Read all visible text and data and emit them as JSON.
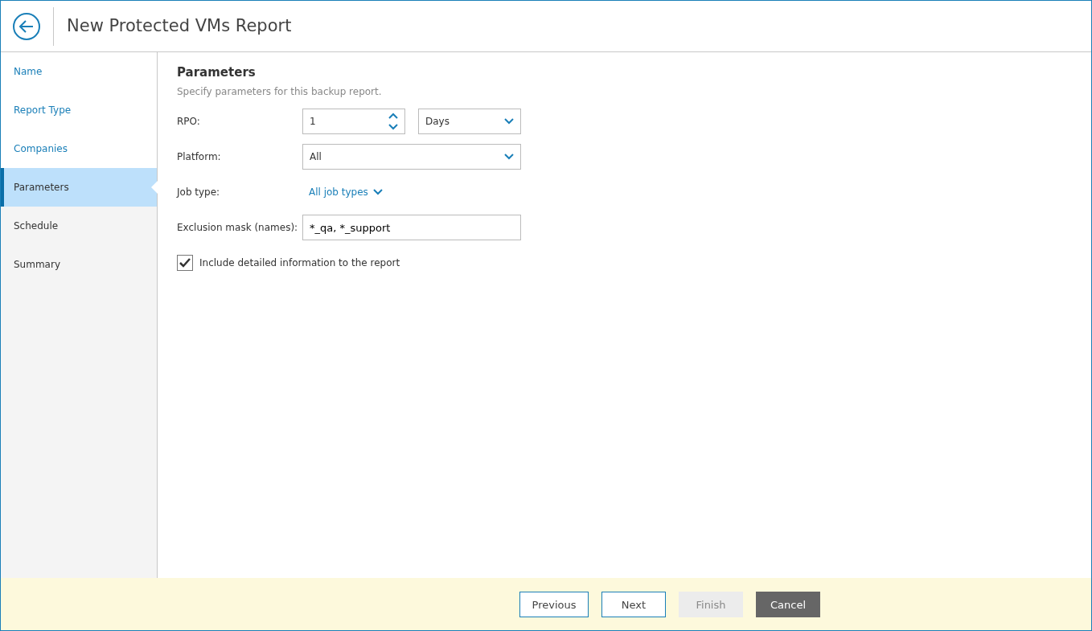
{
  "window": {
    "title": "New Protected VMs Report"
  },
  "steps": [
    {
      "label": "Name",
      "selected": false,
      "completed": true
    },
    {
      "label": "Report Type",
      "selected": false,
      "completed": true
    },
    {
      "label": "Companies",
      "selected": false,
      "completed": true
    },
    {
      "label": "Parameters",
      "selected": true,
      "completed": false
    },
    {
      "label": "Schedule",
      "selected": false,
      "completed": false
    },
    {
      "label": "Summary",
      "selected": false,
      "completed": false
    }
  ],
  "section": {
    "title": "Parameters",
    "description": "Specify parameters for this backup report."
  },
  "fields": [
    {
      "kind": "spin-select",
      "label": "RPO:",
      "value": "1",
      "unit": "Days"
    },
    {
      "kind": "select",
      "label": "Platform:",
      "value": "All"
    },
    {
      "kind": "link-dropdown",
      "label": "Job type:",
      "value": "All job types"
    },
    {
      "kind": "text",
      "label": "Exclusion mask (names):",
      "value": "*_qa, *_support"
    }
  ],
  "checkbox": {
    "label": "Include detailed information to the report",
    "checked": true
  },
  "buttons": [
    {
      "label": "Previous",
      "kind": "outline",
      "disabled": false
    },
    {
      "label": "Next",
      "kind": "outline",
      "disabled": false
    },
    {
      "label": "Finish",
      "kind": "outline",
      "disabled": true
    },
    {
      "label": "Cancel",
      "kind": "dark",
      "disabled": false
    }
  ]
}
